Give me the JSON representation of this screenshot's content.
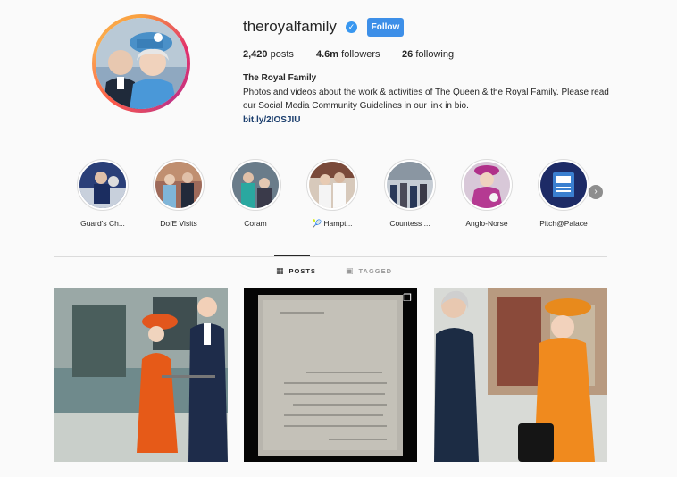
{
  "profile": {
    "username": "theroyalfamily",
    "verified_icon": "verified-badge-icon",
    "follow_label": "Follow",
    "full_name": "The Royal Family",
    "bio": "Photos and videos about the work & activities of The Queen & the Royal Family. Please read our Social Media Community Guidelines in our link in bio.",
    "link": "bit.ly/2IOSJIU"
  },
  "stats": {
    "posts_value": "2,420",
    "posts_label": "posts",
    "followers_value": "4.6m",
    "followers_label": "followers",
    "following_value": "26",
    "following_label": "following"
  },
  "highlights": [
    {
      "label": "Guard's Ch..."
    },
    {
      "label": "DofE Visits"
    },
    {
      "label": "Coram"
    },
    {
      "label": "Hampt...",
      "icon": "🎾"
    },
    {
      "label": "Countess ..."
    },
    {
      "label": "Anglo-Norse"
    },
    {
      "label": "Pitch@Palace"
    }
  ],
  "tabs": {
    "posts_label": "POSTS",
    "tagged_label": "TAGGED"
  },
  "colors": {
    "accent": "#3d8fe8",
    "border": "#dbdbdb",
    "link": "#1c3f6e"
  }
}
